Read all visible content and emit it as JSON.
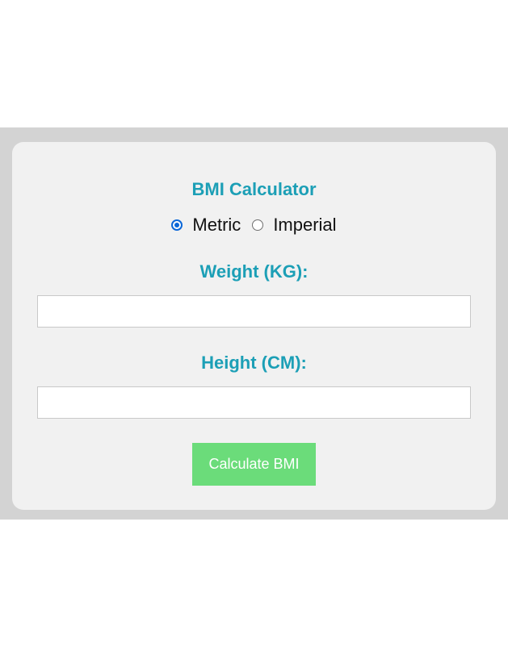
{
  "calculator": {
    "title": "BMI Calculator",
    "units": [
      {
        "label": "Metric",
        "selected": true
      },
      {
        "label": "Imperial",
        "selected": false
      }
    ],
    "weight_label": "Weight (KG):",
    "weight_value": "",
    "height_label": "Height (CM):",
    "height_value": "",
    "button_label": "Calculate BMI"
  },
  "colors": {
    "accent": "#1c9fb6",
    "button": "#6bdc7a",
    "radio_selected": "#0b67d8",
    "card": "#f1f1f1",
    "backdrop": "#d3d3d3"
  }
}
